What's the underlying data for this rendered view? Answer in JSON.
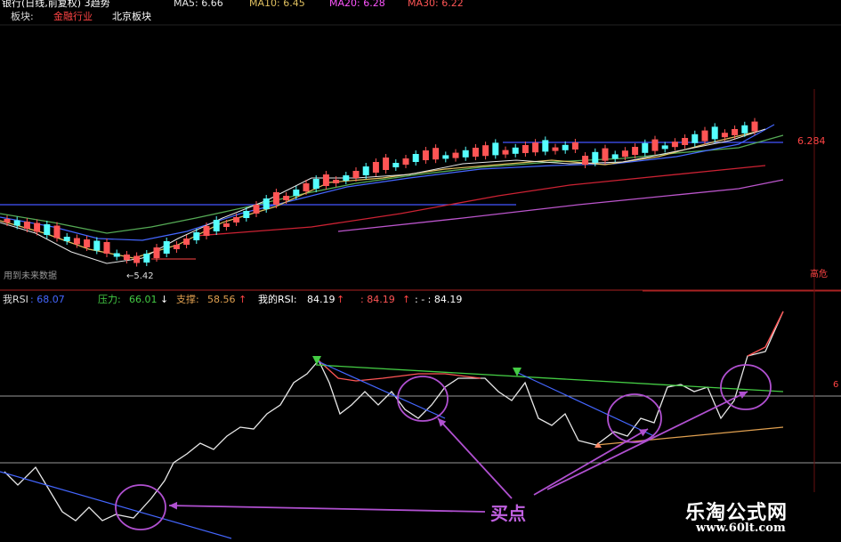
{
  "header": {
    "title": "银行(日线,前复权) 3趋势",
    "ma5": "MA5: 6.66",
    "ma10": "MA10: 6.45",
    "ma20": "MA20: 6.28",
    "ma30": "MA30: 6.22"
  },
  "sector": {
    "label": "板块:",
    "tag1": "金融行业",
    "tag2": "北京板块"
  },
  "price_panel": {
    "low_label": "←5.42",
    "future_note": "用到未来数据",
    "right_price": "6.284",
    "right_tag": "高危"
  },
  "rsi_panel": {
    "rsi_label": "我RSI",
    "rsi_value": ": 68.07",
    "pressure_label": "压力: ",
    "pressure_value": "66.01",
    "pressure_arrow": "↓",
    "support_label": "支撑: ",
    "support_value": "58.56",
    "support_arrow": "↑",
    "my_rsi_label": "我的RSI: ",
    "my_rsi_value": "84.19",
    "my_rsi_arrow": "↑",
    "extra1": ": 84.19",
    "extra1_arrow": "↑",
    "extra2": ": - : 84.19",
    "right_edge": "6"
  },
  "annotation": {
    "buy_point": "买点"
  },
  "watermark": {
    "name": "乐淘公式网",
    "url": "www.60lt.com"
  },
  "colors": {
    "up": "#ff5555",
    "down": "#55ffff",
    "ma5": "#e8e8e8",
    "ma10": "#e0c060",
    "ma20": "#ff55ff",
    "ma30": "#55aa55",
    "rsi": "#e8e8e8",
    "pressure": "#44cc44",
    "support": "#e0a050",
    "purple": "#b050d0"
  }
}
